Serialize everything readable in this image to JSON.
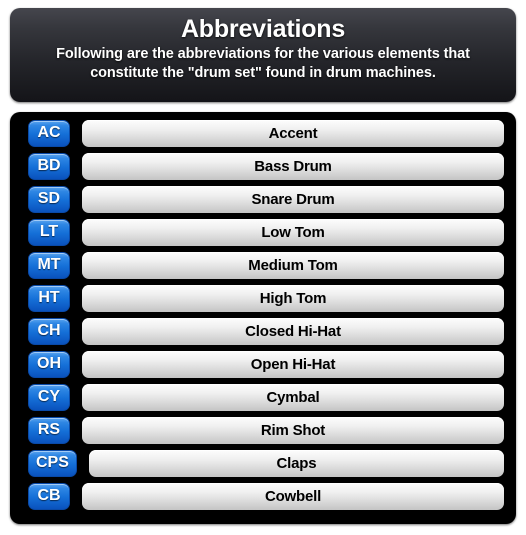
{
  "header": {
    "title": "Abbreviations",
    "subtitle": "Following are the abbreviations for the various elements that constitute the \"drum set\" found in drum machines."
  },
  "colors": {
    "page_background": "#ffffff",
    "panel_background": "#000000",
    "header_gradient_top": "#45464d",
    "header_gradient_bottom": "#141418",
    "badge_blue_top": "#5ba4ef",
    "badge_blue_bottom": "#0a52bd",
    "badge_text": "#ffffff",
    "bar_gradient_top": "#fdfdfd",
    "bar_gradient_bottom": "#c4c4c4",
    "bar_text": "#000000"
  },
  "rows": [
    {
      "abbr": "AC",
      "name": "Accent"
    },
    {
      "abbr": "BD",
      "name": "Bass Drum"
    },
    {
      "abbr": "SD",
      "name": "Snare Drum"
    },
    {
      "abbr": "LT",
      "name": "Low Tom"
    },
    {
      "abbr": "MT",
      "name": "Medium Tom"
    },
    {
      "abbr": "HT",
      "name": "High Tom"
    },
    {
      "abbr": "CH",
      "name": "Closed Hi-Hat"
    },
    {
      "abbr": "OH",
      "name": "Open Hi-Hat"
    },
    {
      "abbr": "CY",
      "name": "Cymbal"
    },
    {
      "abbr": "RS",
      "name": "Rim Shot"
    },
    {
      "abbr": "CPS",
      "name": "Claps"
    },
    {
      "abbr": "CB",
      "name": "Cowbell"
    }
  ]
}
